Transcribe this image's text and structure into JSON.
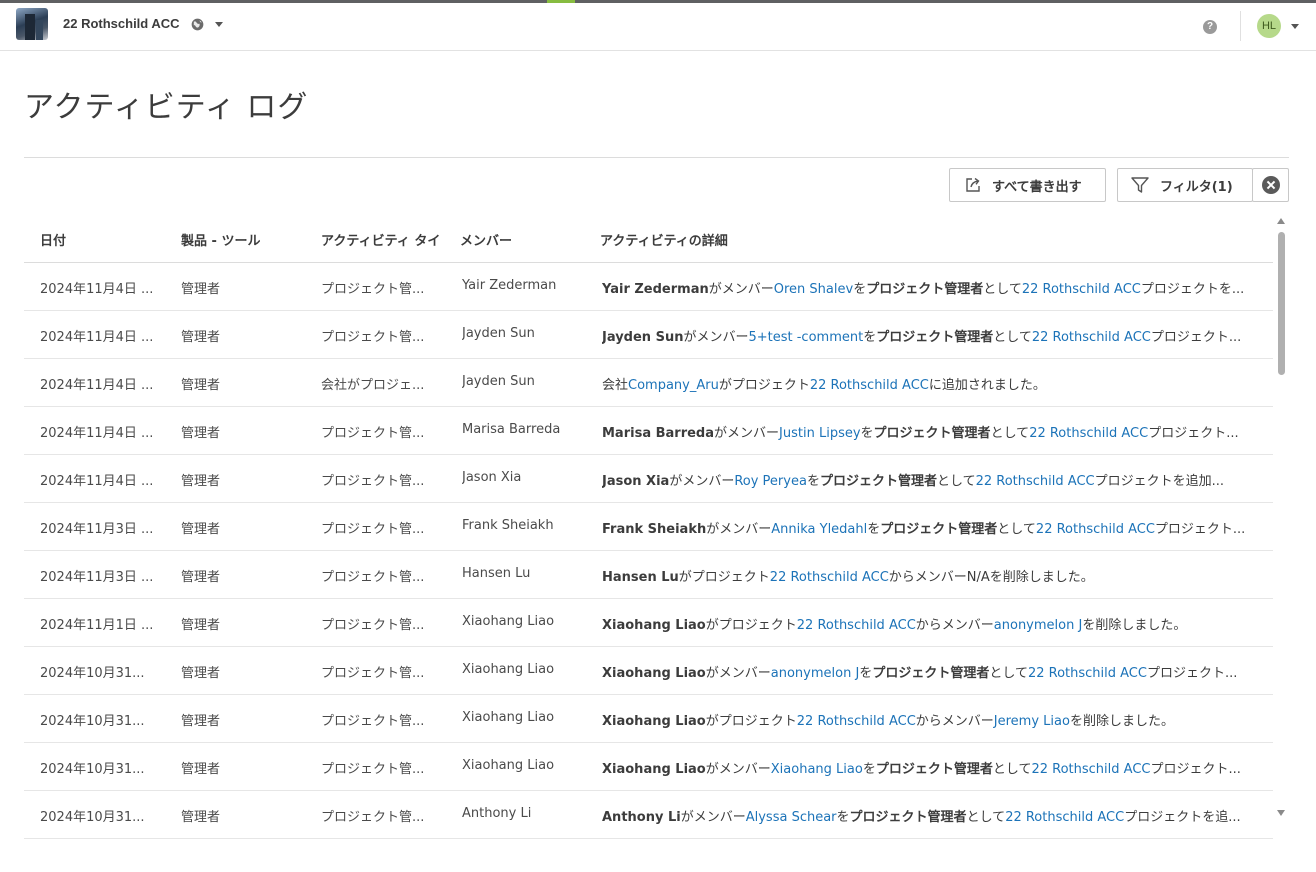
{
  "header": {
    "project_name": "22 Rothschild ACC",
    "avatar_initials": "HL",
    "help_label": "?"
  },
  "page": {
    "title": "アクティビティ ログ",
    "export_label": "すべて書き出す",
    "filter_label": "フィルタ(1)"
  },
  "table": {
    "columns": [
      "日付",
      "製品 - ツール",
      "アクティビティ タイ",
      "メンバー",
      "アクティビティの詳細"
    ],
    "rows": [
      {
        "date": "2024年11月4日 ...",
        "tool": "管理者",
        "type": "プロジェクト管...",
        "member": "Yair Zederman",
        "detail": [
          {
            "t": "Yair Zederman",
            "s": "b"
          },
          {
            "t": "がメンバー"
          },
          {
            "t": "Oren Shalev",
            "s": "l"
          },
          {
            "t": "を"
          },
          {
            "t": "プロジェクト管理者",
            "s": "b"
          },
          {
            "t": "として"
          },
          {
            "t": "22 Rothschild ACC",
            "s": "l"
          },
          {
            "t": "プロジェクトを..."
          }
        ]
      },
      {
        "date": "2024年11月4日 ...",
        "tool": "管理者",
        "type": "プロジェクト管...",
        "member": "Jayden Sun",
        "detail": [
          {
            "t": "Jayden Sun",
            "s": "b"
          },
          {
            "t": "がメンバー"
          },
          {
            "t": "5+test -comment",
            "s": "l"
          },
          {
            "t": "を"
          },
          {
            "t": "プロジェクト管理者",
            "s": "b"
          },
          {
            "t": "として"
          },
          {
            "t": "22 Rothschild ACC",
            "s": "l"
          },
          {
            "t": "プロジェクト..."
          }
        ]
      },
      {
        "date": "2024年11月4日 ...",
        "tool": "管理者",
        "type": "会社がプロジェ...",
        "member": "Jayden Sun",
        "detail": [
          {
            "t": "会社"
          },
          {
            "t": "Company_Aru",
            "s": "l"
          },
          {
            "t": "がプロジェクト"
          },
          {
            "t": "22 Rothschild ACC",
            "s": "l"
          },
          {
            "t": "に追加されました。"
          }
        ]
      },
      {
        "date": "2024年11月4日 ...",
        "tool": "管理者",
        "type": "プロジェクト管...",
        "member": "Marisa Barreda",
        "detail": [
          {
            "t": "Marisa Barreda",
            "s": "b"
          },
          {
            "t": "がメンバー"
          },
          {
            "t": "Justin Lipsey",
            "s": "l"
          },
          {
            "t": "を"
          },
          {
            "t": "プロジェクト管理者",
            "s": "b"
          },
          {
            "t": "として"
          },
          {
            "t": "22 Rothschild ACC",
            "s": "l"
          },
          {
            "t": "プロジェクト..."
          }
        ]
      },
      {
        "date": "2024年11月4日 ...",
        "tool": "管理者",
        "type": "プロジェクト管...",
        "member": "Jason Xia",
        "detail": [
          {
            "t": "Jason Xia",
            "s": "b"
          },
          {
            "t": "がメンバー"
          },
          {
            "t": "Roy Peryea",
            "s": "l"
          },
          {
            "t": "を"
          },
          {
            "t": "プロジェクト管理者",
            "s": "b"
          },
          {
            "t": "として"
          },
          {
            "t": "22 Rothschild ACC",
            "s": "l"
          },
          {
            "t": "プロジェクトを追加..."
          }
        ]
      },
      {
        "date": "2024年11月3日 ...",
        "tool": "管理者",
        "type": "プロジェクト管...",
        "member": "Frank Sheiakh",
        "detail": [
          {
            "t": "Frank Sheiakh",
            "s": "b"
          },
          {
            "t": "がメンバー"
          },
          {
            "t": "Annika Yledahl",
            "s": "l"
          },
          {
            "t": "を"
          },
          {
            "t": "プロジェクト管理者",
            "s": "b"
          },
          {
            "t": "として"
          },
          {
            "t": "22 Rothschild ACC",
            "s": "l"
          },
          {
            "t": "プロジェクト..."
          }
        ]
      },
      {
        "date": "2024年11月3日 ...",
        "tool": "管理者",
        "type": "プロジェクト管...",
        "member": "Hansen Lu",
        "detail": [
          {
            "t": "Hansen Lu",
            "s": "b"
          },
          {
            "t": "がプロジェクト"
          },
          {
            "t": "22 Rothschild ACC",
            "s": "l"
          },
          {
            "t": "からメンバーN/Aを削除しました。"
          }
        ]
      },
      {
        "date": "2024年11月1日 ...",
        "tool": "管理者",
        "type": "プロジェクト管...",
        "member": "Xiaohang Liao",
        "detail": [
          {
            "t": "Xiaohang Liao",
            "s": "b"
          },
          {
            "t": "がプロジェクト"
          },
          {
            "t": "22 Rothschild ACC",
            "s": "l"
          },
          {
            "t": "からメンバー"
          },
          {
            "t": "anonymelon J",
            "s": "l"
          },
          {
            "t": "を削除しました。"
          }
        ]
      },
      {
        "date": "2024年10月31...",
        "tool": "管理者",
        "type": "プロジェクト管...",
        "member": "Xiaohang Liao",
        "detail": [
          {
            "t": "Xiaohang Liao",
            "s": "b"
          },
          {
            "t": "がメンバー"
          },
          {
            "t": "anonymelon J",
            "s": "l"
          },
          {
            "t": "を"
          },
          {
            "t": "プロジェクト管理者",
            "s": "b"
          },
          {
            "t": "として"
          },
          {
            "t": "22 Rothschild ACC",
            "s": "l"
          },
          {
            "t": "プロジェクト..."
          }
        ]
      },
      {
        "date": "2024年10月31...",
        "tool": "管理者",
        "type": "プロジェクト管...",
        "member": "Xiaohang Liao",
        "detail": [
          {
            "t": "Xiaohang Liao",
            "s": "b"
          },
          {
            "t": "がプロジェクト"
          },
          {
            "t": "22 Rothschild ACC",
            "s": "l"
          },
          {
            "t": "からメンバー"
          },
          {
            "t": "Jeremy Liao",
            "s": "l"
          },
          {
            "t": "を削除しました。"
          }
        ]
      },
      {
        "date": "2024年10月31...",
        "tool": "管理者",
        "type": "プロジェクト管...",
        "member": "Xiaohang Liao",
        "detail": [
          {
            "t": "Xiaohang Liao",
            "s": "b"
          },
          {
            "t": "がメンバー"
          },
          {
            "t": "Xiaohang Liao",
            "s": "l"
          },
          {
            "t": "を"
          },
          {
            "t": "プロジェクト管理者",
            "s": "b"
          },
          {
            "t": "として"
          },
          {
            "t": "22 Rothschild ACC",
            "s": "l"
          },
          {
            "t": "プロジェクト..."
          }
        ]
      },
      {
        "date": "2024年10月31...",
        "tool": "管理者",
        "type": "プロジェクト管...",
        "member": "Anthony Li",
        "detail": [
          {
            "t": "Anthony Li",
            "s": "b"
          },
          {
            "t": "がメンバー"
          },
          {
            "t": "Alyssa Schear",
            "s": "l"
          },
          {
            "t": "を"
          },
          {
            "t": "プロジェクト管理者",
            "s": "b"
          },
          {
            "t": "として"
          },
          {
            "t": "22 Rothschild ACC",
            "s": "l"
          },
          {
            "t": "プロジェクトを追..."
          }
        ]
      }
    ]
  },
  "colors": {
    "link": "#1c73b8",
    "accent": "#87bc40",
    "avatar_bg": "#b6d98a"
  }
}
